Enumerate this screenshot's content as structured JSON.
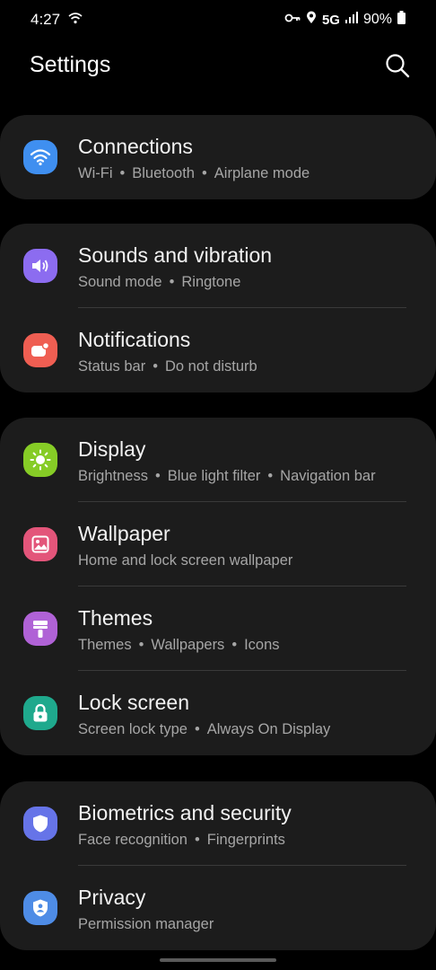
{
  "status_bar": {
    "time": "4:27",
    "network": "5G",
    "battery": "90%"
  },
  "header": {
    "title": "Settings"
  },
  "groups": [
    [
      {
        "title": "Connections",
        "sub": [
          "Wi-Fi",
          "Bluetooth",
          "Airplane mode"
        ],
        "icon": "wifi-icon",
        "color": "#3f8ff0"
      }
    ],
    [
      {
        "title": "Sounds and vibration",
        "sub": [
          "Sound mode",
          "Ringtone"
        ],
        "icon": "volume-icon",
        "color": "#8c6cf0"
      },
      {
        "title": "Notifications",
        "sub": [
          "Status bar",
          "Do not disturb"
        ],
        "icon": "notification-icon",
        "color": "#ef5e52"
      }
    ],
    [
      {
        "title": "Display",
        "sub": [
          "Brightness",
          "Blue light filter",
          "Navigation bar"
        ],
        "icon": "brightness-icon",
        "color": "#86cc26"
      },
      {
        "title": "Wallpaper",
        "sub": [
          "Home and lock screen wallpaper"
        ],
        "icon": "image-icon",
        "color": "#e3557a"
      },
      {
        "title": "Themes",
        "sub": [
          "Themes",
          "Wallpapers",
          "Icons"
        ],
        "icon": "paint-brush-icon",
        "color": "#b062d6"
      },
      {
        "title": "Lock screen",
        "sub": [
          "Screen lock type",
          "Always On Display"
        ],
        "icon": "lock-icon",
        "color": "#1fa98d"
      }
    ],
    [
      {
        "title": "Biometrics and security",
        "sub": [
          "Face recognition",
          "Fingerprints"
        ],
        "icon": "shield-icon",
        "color": "#6674e8"
      },
      {
        "title": "Privacy",
        "sub": [
          "Permission manager"
        ],
        "icon": "privacy-icon",
        "color": "#4e8ce6"
      }
    ]
  ]
}
